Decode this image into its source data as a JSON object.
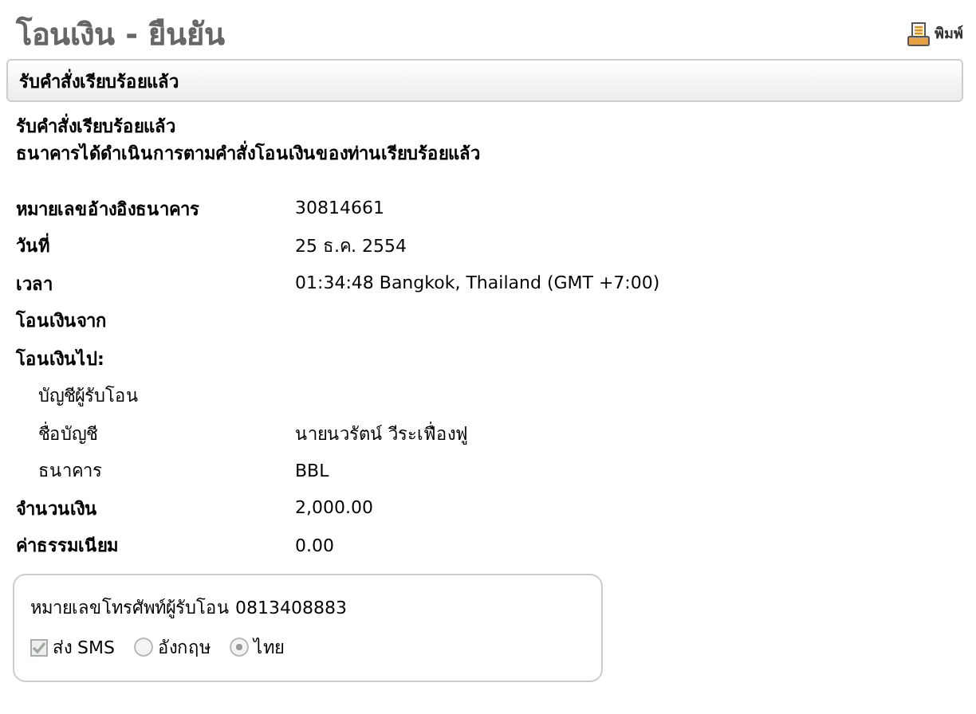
{
  "page": {
    "title": "โอนเงิน - ยืนยัน",
    "print_link": "พิมพ์"
  },
  "section_bar": {
    "title": "รับคำสั่งเรียบร้อยแล้ว"
  },
  "message": {
    "heading": "รับคำสั่งเรียบร้อยแล้ว",
    "body": "ธนาคารได้ดำเนินการตามคำสั่งโอนเงินของท่านเรียบร้อยแล้ว"
  },
  "details": [
    {
      "kind": "main",
      "label": "หมายเลขอ้างอิงธนาคาร",
      "value": "30814661"
    },
    {
      "kind": "main",
      "label": "วันที่",
      "value": "25 ธ.ค. 2554"
    },
    {
      "kind": "main",
      "label": "เวลา",
      "value": "01:34:48 Bangkok, Thailand (GMT +7:00)"
    },
    {
      "kind": "main",
      "label": "โอนเงินจาก"
    },
    {
      "kind": "main",
      "label": "โอนเงินไป:"
    },
    {
      "kind": "sub",
      "label": "บัญชีผู้รับโอน"
    },
    {
      "kind": "sub",
      "label": "ชื่อบัญชี",
      "value": "นายนวรัตน์ วีระเฟื่องฟู"
    },
    {
      "kind": "sub",
      "label": "ธนาคาร",
      "value": "BBL"
    },
    {
      "kind": "main",
      "label": "จำนวนเงิน",
      "value": "2,000.00"
    },
    {
      "kind": "main",
      "label": "ค่าธรรมเนียม",
      "value": "0.00"
    }
  ],
  "sms_box": {
    "phone_text": "หมายเลขโทรศัพท์ผู้รับโอน 0813408883",
    "send_sms": {
      "label": "ส่ง SMS",
      "checked": true,
      "disabled": true
    },
    "languages": [
      {
        "label": "อังกฤษ",
        "selected": false,
        "disabled": true
      },
      {
        "label": "ไทย",
        "selected": true,
        "disabled": true
      }
    ]
  }
}
